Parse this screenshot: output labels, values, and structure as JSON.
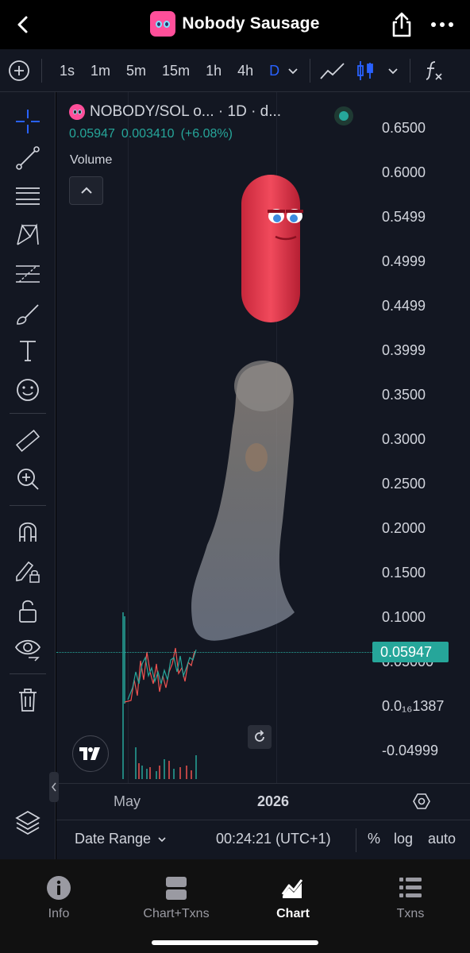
{
  "header": {
    "title": "Nobody Sausage",
    "icons": [
      "back-chevron-icon",
      "share-icon",
      "more-icon"
    ]
  },
  "toolbar": {
    "timeframes": [
      "1s",
      "1m",
      "5m",
      "15m",
      "1h",
      "4h",
      "D"
    ],
    "active_timeframe": "D",
    "icons": [
      "add-indicator-icon",
      "chevron-down-icon",
      "line-chart-icon",
      "candles-icon",
      "chevron-down-icon",
      "fx-icon"
    ]
  },
  "side_tools": [
    "crosshair-icon",
    "trend-line-icon",
    "horizontal-lines-icon",
    "pattern-icon",
    "fib-icon",
    "brush-icon",
    "text-icon",
    "emoji-icon",
    "ruler-icon",
    "zoom-in-icon",
    "magnet-icon",
    "lock-drawing-icon",
    "unlock-icon",
    "eye-icon",
    "trash-icon",
    "layers-icon"
  ],
  "legend": {
    "symbol": "NOBODY/SOL o... · 1D · d...",
    "price": "0.05947",
    "change": "0.003410",
    "change_pct": "(+6.08%)",
    "volume_label": "Volume"
  },
  "price_axis": {
    "labels": [
      "0.6500",
      "0.6000",
      "0.5499",
      "0.4999",
      "0.4499",
      "0.3999",
      "0.3500",
      "0.3000",
      "0.2500",
      "0.2000",
      "0.1500",
      "0.1000",
      "0.05000",
      "0.0₁₆1387",
      "-0.04999"
    ],
    "current_price": "0.05947"
  },
  "time_axis": {
    "labels": [
      "May",
      "2026"
    ]
  },
  "chart_bottom": {
    "date_range": "Date Range",
    "time": "00:24:21 (UTC+1)",
    "percent": "%",
    "log": "log",
    "auto": "auto"
  },
  "bottom_nav": {
    "items": [
      {
        "label": "Info",
        "icon": "info-icon"
      },
      {
        "label": "Chart+Txns",
        "icon": "split-view-icon"
      },
      {
        "label": "Chart",
        "icon": "chart-icon"
      },
      {
        "label": "Txns",
        "icon": "list-icon"
      }
    ],
    "active": "Chart"
  },
  "colors": {
    "up": "#26a69a",
    "down": "#ef5350",
    "accent": "#2962ff",
    "background": "#131722"
  }
}
